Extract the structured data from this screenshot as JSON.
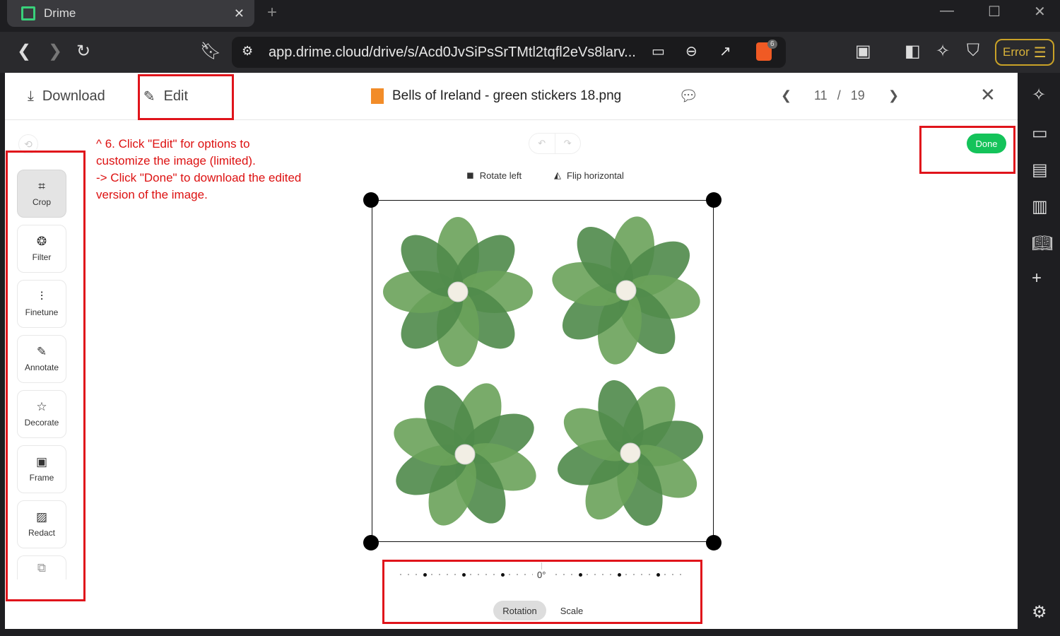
{
  "browser": {
    "tab_title": "Drime",
    "url": "app.drime.cloud/drive/s/Acd0JvSiPsSrTMtl2tqfl2eVs8larv...",
    "shield_badge": "6",
    "error_label": "Error"
  },
  "header": {
    "download_label": "Download",
    "edit_label": "Edit",
    "file_name": "Bells of Ireland - green stickers 18.png",
    "page_current": "11",
    "page_sep": "/",
    "page_total": "19"
  },
  "tools": [
    {
      "label": "Crop",
      "icon": "crop-icon"
    },
    {
      "label": "Filter",
      "icon": "filter-icon"
    },
    {
      "label": "Finetune",
      "icon": "sliders-icon"
    },
    {
      "label": "Annotate",
      "icon": "pencil-icon"
    },
    {
      "label": "Decorate",
      "icon": "star-icon"
    },
    {
      "label": "Frame",
      "icon": "frame-icon"
    },
    {
      "label": "Redact",
      "icon": "redact-icon"
    }
  ],
  "annotation": {
    "line1": "^ 6. Click \"Edit\" for options to",
    "line2": "customize the image (limited).",
    "line3": "-> Click \"Done\" to download the edited",
    "line4": "version of the image."
  },
  "editor": {
    "done_label": "Done",
    "rotate_left_label": "Rotate left",
    "flip_horizontal_label": "Flip horizontal",
    "rotation_value": "0°",
    "tab_rotation": "Rotation",
    "tab_scale": "Scale"
  },
  "colors": {
    "done": "#14c35a",
    "annotation": "#e0141b"
  }
}
